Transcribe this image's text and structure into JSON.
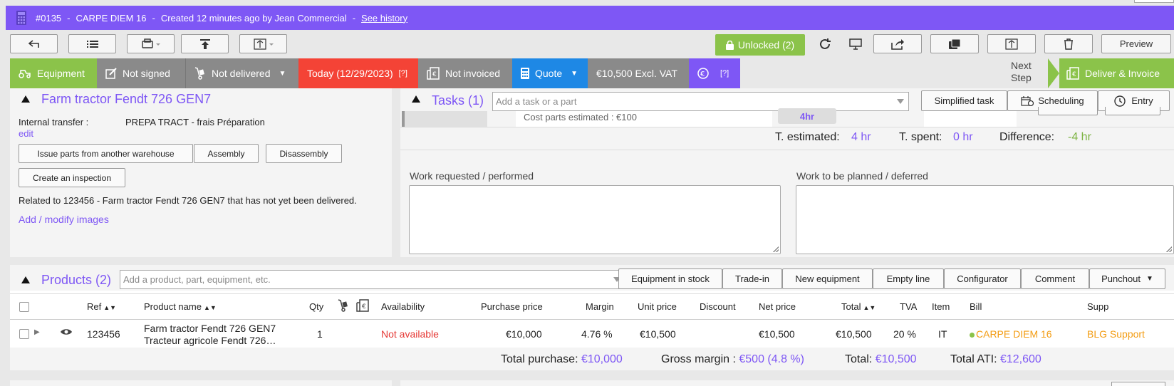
{
  "header": {
    "record_id": "#0135",
    "customer": "CARPE DIEM 16",
    "created": "Created 12 minutes ago by Jean Commercial",
    "history_link": "See history",
    "sep": "-"
  },
  "toolbar": {
    "unlocked_label": "Unlocked (2)",
    "preview_label": "Preview"
  },
  "status": {
    "equipment": "Equipment",
    "not_signed": "Not signed",
    "not_delivered": "Not delivered",
    "today": "Today (12/29/2023)",
    "today_hint": "[?]",
    "not_invoiced": "Not invoiced",
    "quote": "Quote",
    "amount": "€10,500 Excl. VAT",
    "euro_hint": "[?]",
    "next_step_line1": "Next",
    "next_step_line2": "Step",
    "deliver_invoice": "Deliver & Invoice",
    "colors": {
      "green": "#8bc34a",
      "gray": "#8a8a8a",
      "red": "#f44336",
      "blue": "#1e88e5",
      "purple": "#7e57f5"
    }
  },
  "equipment_panel": {
    "title": "Farm tractor Fendt 726 GEN7",
    "internal_transfer_label": "Internal transfer :",
    "internal_transfer_value": "PREPA TRACT - frais Préparation",
    "edit_link": "edit",
    "issue_parts_button": "Issue parts from another warehouse",
    "assembly_button": "Assembly",
    "disassembly_button": "Disassembly",
    "inspection_button": "Create an inspection",
    "related_text": "Related to 123456 - Farm tractor Fendt 726 GEN7 that has not yet been delivered.",
    "images_link": "Add / modify images"
  },
  "tasks_panel": {
    "title": "Tasks (1)",
    "input_placeholder": "Add a task or a part",
    "simplified_task_button": "Simplified task",
    "scheduling_button": "Scheduling",
    "entry_button": "Entry",
    "cost_parts": "Cost parts estimated : €100",
    "hours_badge": "4hr",
    "estimated_label": "T. estimated:",
    "estimated_value": "4 hr",
    "spent_label": "T. spent:",
    "spent_value": "0 hr",
    "difference_label": "Difference:",
    "difference_value": "-4 hr",
    "work_requested_label": "Work requested / performed",
    "work_planned_label": "Work to be planned / deferred"
  },
  "products_panel": {
    "title": "Products (2)",
    "input_placeholder": "Add a product, part, equipment, etc.",
    "buttons": [
      "Equipment in stock",
      "Trade-in",
      "New equipment",
      "Empty line",
      "Configurator",
      "Comment",
      "Punchout"
    ],
    "columns": {
      "ref": "Ref",
      "product_name": "Product name",
      "qty": "Qty",
      "availability": "Availability",
      "purchase_price": "Purchase price",
      "margin": "Margin",
      "unit_price": "Unit price",
      "discount": "Discount",
      "net_price": "Net price",
      "total": "Total",
      "tva": "TVA",
      "item": "Item",
      "bill": "Bill",
      "supp": "Supp"
    },
    "rows": [
      {
        "ref": "123456",
        "name_line1": "Farm tractor Fendt 726 GEN7",
        "name_line2": "Tracteur agricole Fendt 726…",
        "qty": "1",
        "availability": "Not available",
        "purchase_price": "€10,000",
        "margin": "4.76 %",
        "unit_price": "€10,500",
        "net_price": "€10,500",
        "total": "€10,500",
        "tva": "20 %",
        "item": "IT",
        "bill": "CARPE DIEM 16",
        "supp": "BLG Support"
      }
    ],
    "totals": {
      "purchase_label": "Total purchase:",
      "purchase_value": "€10,000",
      "gross_margin_label": "Gross margin :",
      "gross_margin_value": "€500 (4.8 %)",
      "total_label": "Total:",
      "total_value": "€10,500",
      "total_ati_label": "Total ATI:",
      "total_ati_value": "€12,600"
    }
  }
}
